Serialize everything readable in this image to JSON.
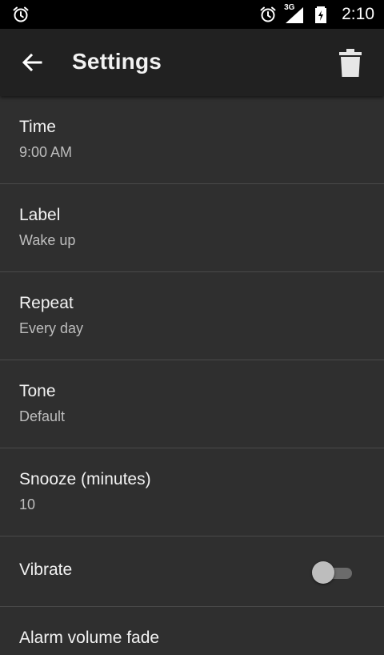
{
  "status_bar": {
    "time": "2:10",
    "network_type": "3G",
    "icons": [
      "alarm-icon",
      "alarm-clock-icon",
      "signal-icon",
      "battery-charging-icon"
    ]
  },
  "app_bar": {
    "title": "Settings",
    "back_icon": "arrow-back-icon",
    "delete_icon": "trash-icon"
  },
  "settings": {
    "time": {
      "label": "Time",
      "value": "9:00 AM"
    },
    "label": {
      "label": "Label",
      "value": "Wake up"
    },
    "repeat": {
      "label": "Repeat",
      "value": "Every day"
    },
    "tone": {
      "label": "Tone",
      "value": "Default"
    },
    "snooze": {
      "label": "Snooze (minutes)",
      "value": "10"
    },
    "vibrate": {
      "label": "Vibrate",
      "enabled": false
    },
    "volume_fade": {
      "label": "Alarm volume fade"
    }
  },
  "colors": {
    "background": "#2f2f2f",
    "app_bar": "#212121",
    "status_bar": "#000000",
    "divider": "#4a4a4a",
    "primary_text": "#f2f2f2",
    "secondary_text": "#bdbdbd"
  }
}
